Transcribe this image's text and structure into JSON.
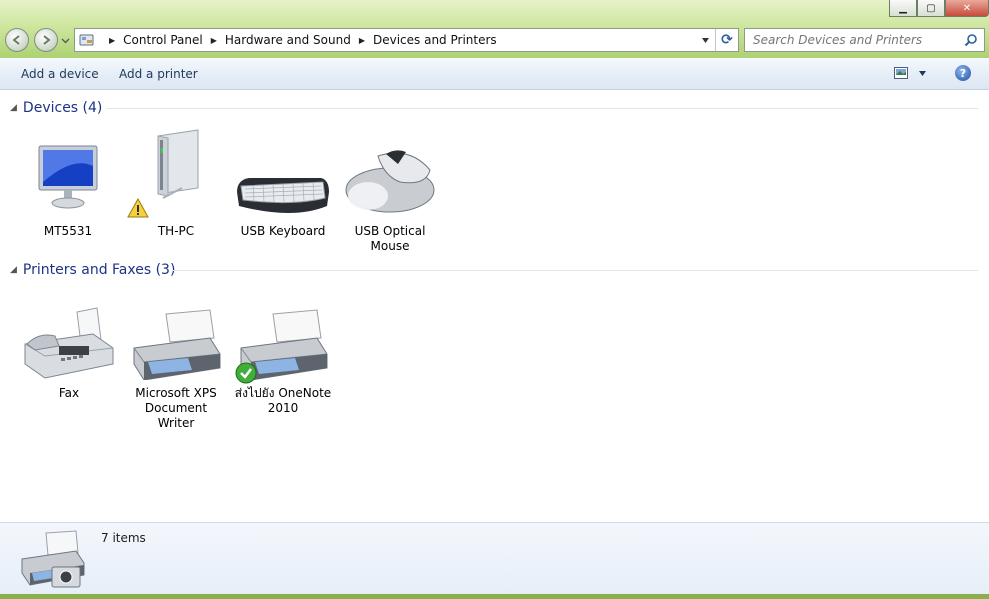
{
  "window": {
    "minimize_glyph": "▁",
    "maximize_glyph": "▢",
    "close_glyph": "✕"
  },
  "nav": {
    "back_icon": "arrow-left-icon",
    "forward_icon": "arrow-right-icon",
    "recent_icon": "chevron-down-icon"
  },
  "address": {
    "crumbs": [
      "Control Panel",
      "Hardware and Sound",
      "Devices and Printers"
    ],
    "refresh_glyph": "⟳"
  },
  "search": {
    "placeholder": "Search Devices and Printers"
  },
  "toolbar": {
    "add_device": "Add a device",
    "add_printer": "Add a printer",
    "help_glyph": "?"
  },
  "groups": {
    "devices": {
      "title": "Devices (4)",
      "items": [
        {
          "label": "MT5531",
          "icon": "monitor-icon"
        },
        {
          "label": "TH-PC",
          "icon": "computer-tower-icon",
          "warning": true
        },
        {
          "label": "USB Keyboard",
          "icon": "keyboard-icon"
        },
        {
          "label": "USB Optical\nMouse",
          "line1": "USB Optical",
          "line2": "Mouse",
          "icon": "mouse-icon"
        }
      ]
    },
    "printers": {
      "title": "Printers and Faxes (3)",
      "items": [
        {
          "label": "Fax",
          "icon": "fax-icon"
        },
        {
          "line1": "Microsoft XPS",
          "line2": "Document Writer",
          "icon": "printer-icon"
        },
        {
          "line1": "ส่งไปยัง OneNote",
          "line2": "2010",
          "icon": "printer-icon",
          "default": true
        }
      ]
    }
  },
  "details": {
    "count_text": "7 items"
  },
  "colors": {
    "group_title": "#1e3287",
    "toolbar_text": "#1e395b",
    "chrome_green": "#b9d67a"
  }
}
